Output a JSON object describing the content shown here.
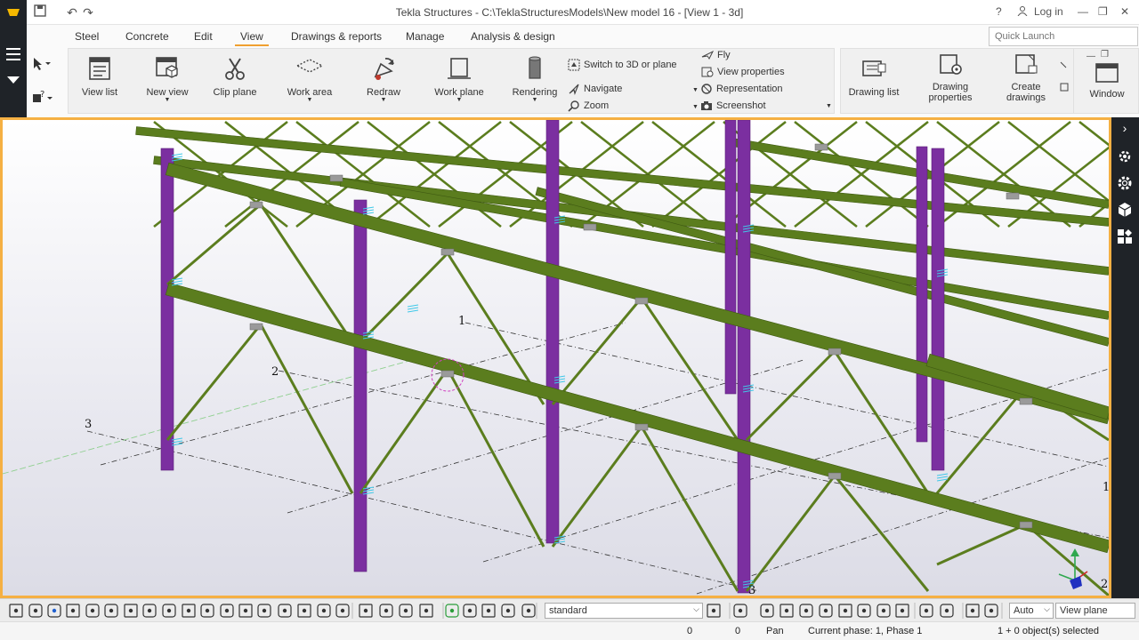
{
  "title_bar": {
    "title": "Tekla Structures - C:\\TeklaStructuresModels\\New model 16  - [View 1 - 3d]",
    "help": "?",
    "login": "Log in"
  },
  "tabs": [
    "Steel",
    "Concrete",
    "Edit",
    "View",
    "Drawings & reports",
    "Manage",
    "Analysis & design"
  ],
  "quick_launch": {
    "placeholder": "Quick Launch"
  },
  "ribbon": {
    "view_list": "View list",
    "new_view": "New view",
    "clip_plane": "Clip plane",
    "work_area": "Work area",
    "redraw": "Redraw",
    "work_plane": "Work plane",
    "rendering": "Rendering",
    "switch_3d": "Switch to 3D or plane",
    "navigate": "Navigate",
    "zoom": "Zoom",
    "fly": "Fly",
    "view_properties": "View properties",
    "representation": "Representation",
    "screenshot": "Screenshot",
    "drawing_list": "Drawing list",
    "drawing_properties_1": "Drawing",
    "drawing_properties_2": "properties",
    "create_drawings_1": "Create",
    "create_drawings_2": "drawings",
    "window": "Window"
  },
  "viewport": {
    "grid_labels": [
      "1",
      "2",
      "3",
      "1",
      "2",
      "3"
    ]
  },
  "bottom_toolbar": {
    "filter_select": "standard",
    "snap_select": "Auto",
    "plane_select": "View plane"
  },
  "status_bar": {
    "coord_x": "0",
    "coord_y": "0",
    "mode": "Pan",
    "phase": "Current phase: 1, Phase 1",
    "selection": "1 + 0 object(s) selected"
  },
  "colors": {
    "column": "#7b2fa0",
    "beam": "#5b7d1e",
    "accent": "#f5b043",
    "dark": "#1f2328"
  }
}
